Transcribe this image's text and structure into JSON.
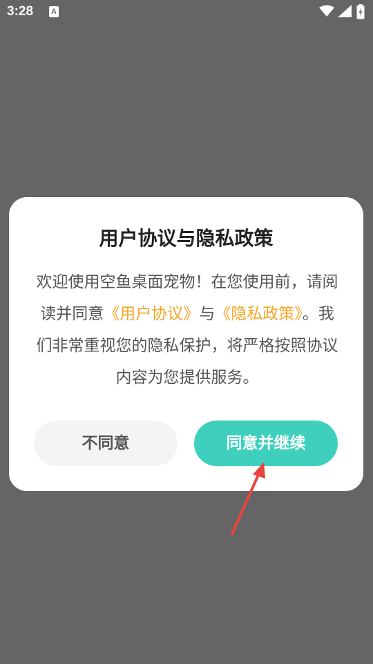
{
  "status_bar": {
    "time": "3:28",
    "notification_icon": "A",
    "icons": [
      "wifi-icon",
      "signal-icon",
      "battery-icon"
    ]
  },
  "dialog": {
    "title": "用户协议与隐私政策",
    "body": {
      "part1": "欢迎使用空鱼桌面宠物！在您使用前，请阅读并同意",
      "link1": "《用户协议》",
      "part2": "与",
      "link2": "《隐私政策》",
      "part3": "。我们非常重视您的隐私保护，将严格按照协议内容为您提供服务。"
    },
    "disagree_label": "不同意",
    "agree_label": "同意并继续"
  },
  "colors": {
    "overlay": "#656567",
    "link": "#f5a623",
    "accent": "#3fd0bd",
    "arrow": "#e8453c"
  }
}
